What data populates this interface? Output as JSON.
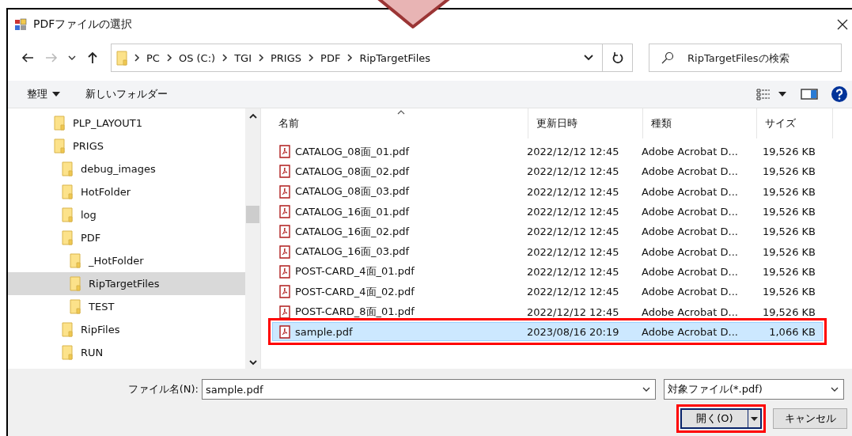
{
  "window": {
    "title": "PDFファイルの選択"
  },
  "address": {
    "crumbs": [
      "PC",
      "OS (C:)",
      "TGI",
      "PRIGS",
      "PDF",
      "RipTargetFiles"
    ]
  },
  "search": {
    "placeholder": "RipTargetFilesの検索"
  },
  "toolbar": {
    "organize": "整理",
    "new_folder": "新しいフォルダー"
  },
  "tree": [
    {
      "label": "PLP_LAYOUT1",
      "selected": false
    },
    {
      "label": "PRIGS",
      "selected": false,
      "children": [
        {
          "label": "debug_images",
          "selected": false
        },
        {
          "label": "HotFolder",
          "selected": false
        },
        {
          "label": "log",
          "selected": false
        },
        {
          "label": "PDF",
          "selected": false,
          "children": [
            {
              "label": "_HotFolder",
              "selected": false
            },
            {
              "label": "RipTargetFiles",
              "selected": true
            },
            {
              "label": "TEST",
              "selected": false
            }
          ]
        },
        {
          "label": "RipFiles",
          "selected": false
        },
        {
          "label": "RUN",
          "selected": false
        }
      ]
    }
  ],
  "table": {
    "columns": [
      "名前",
      "更新日時",
      "種類",
      "サイズ"
    ],
    "rows": [
      {
        "name": "CATALOG_08面_01.pdf",
        "date": "2022/12/12 12:45",
        "type": "Adobe Acrobat D...",
        "size": "19,526 KB",
        "selected": false,
        "highlighted": false
      },
      {
        "name": "CATALOG_08面_02.pdf",
        "date": "2022/12/12 12:45",
        "type": "Adobe Acrobat D...",
        "size": "19,526 KB",
        "selected": false,
        "highlighted": false
      },
      {
        "name": "CATALOG_08面_03.pdf",
        "date": "2022/12/12 12:45",
        "type": "Adobe Acrobat D...",
        "size": "19,526 KB",
        "selected": false,
        "highlighted": false
      },
      {
        "name": "CATALOG_16面_01.pdf",
        "date": "2022/12/12 12:45",
        "type": "Adobe Acrobat D...",
        "size": "19,526 KB",
        "selected": false,
        "highlighted": false
      },
      {
        "name": "CATALOG_16面_02.pdf",
        "date": "2022/12/12 12:45",
        "type": "Adobe Acrobat D...",
        "size": "19,526 KB",
        "selected": false,
        "highlighted": false
      },
      {
        "name": "CATALOG_16面_03.pdf",
        "date": "2022/12/12 12:45",
        "type": "Adobe Acrobat D...",
        "size": "19,526 KB",
        "selected": false,
        "highlighted": false
      },
      {
        "name": "POST-CARD_4面_01.pdf",
        "date": "2022/12/12 12:45",
        "type": "Adobe Acrobat D...",
        "size": "19,526 KB",
        "selected": false,
        "highlighted": false
      },
      {
        "name": "POST-CARD_4面_02.pdf",
        "date": "2022/12/12 12:45",
        "type": "Adobe Acrobat D...",
        "size": "19,526 KB",
        "selected": false,
        "highlighted": false
      },
      {
        "name": "POST-CARD_8面_01.pdf",
        "date": "2022/12/12 12:45",
        "type": "Adobe Acrobat D...",
        "size": "19,526 KB",
        "selected": false,
        "highlighted": false
      },
      {
        "name": "sample.pdf",
        "date": "2023/08/16 20:19",
        "type": "Adobe Acrobat D...",
        "size": "1,066 KB",
        "selected": true,
        "highlighted": true
      }
    ]
  },
  "footer": {
    "filename_label": "ファイル名(N):",
    "filename_value": "sample.pdf",
    "filter": "対象ファイル(*.pdf)",
    "buttons": [
      {
        "label": "開く(O)",
        "kind": "split",
        "highlighted": true
      },
      {
        "label": "キャンセル",
        "kind": "plain",
        "highlighted": false
      }
    ]
  }
}
